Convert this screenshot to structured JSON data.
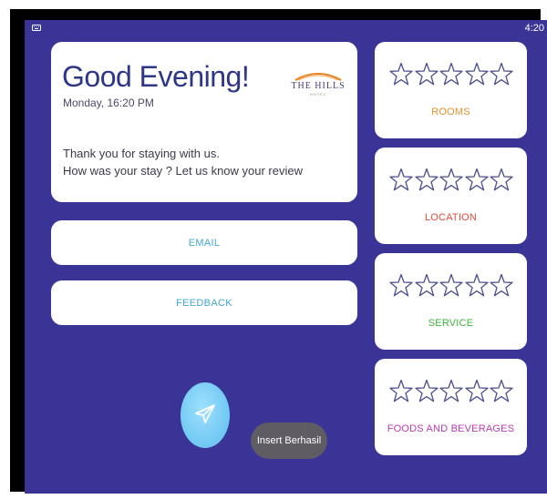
{
  "status_bar": {
    "time": "4:20",
    "notification_icon": "keyboard-icon"
  },
  "greeting": {
    "title": "Good Evening!",
    "date": "Monday, 16:20 PM",
    "message_line1": "Thank you for staying with us.",
    "message_line2": "How was your stay ? Let us know your review",
    "logo_text": "THE HILLS",
    "logo_subtext": "HOTEL"
  },
  "actions": {
    "email_label": "EMAIL",
    "feedback_label": "FEEDBACK",
    "send_icon": "send-icon"
  },
  "ratings": [
    {
      "label": "ROOMS",
      "color": "#e0932b",
      "stars": 0,
      "max": 5
    },
    {
      "label": "LOCATION",
      "color": "#e04a3a",
      "stars": 0,
      "max": 5
    },
    {
      "label": "SERVICE",
      "color": "#3bb33b",
      "stars": 0,
      "max": 5
    },
    {
      "label": "FOODS AND BEVERAGES",
      "color": "#b83bb3",
      "stars": 0,
      "max": 5
    }
  ],
  "toast": {
    "text": "Insert Berhasil"
  },
  "colors": {
    "background": "#3b3497",
    "card": "#ffffff",
    "title": "#2e3787",
    "button_text": "#45a6cf",
    "star_outline": "#4a4f8f",
    "fab": "#6fc8f2",
    "toast": "#5f5c63"
  }
}
